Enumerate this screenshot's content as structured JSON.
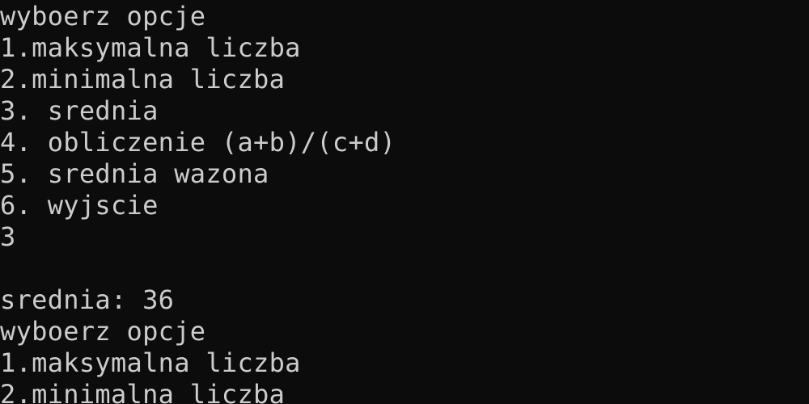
{
  "console": {
    "lines": [
      "wyboerz opcje",
      "1.maksymalna liczba",
      "2.minimalna liczba",
      "3. srednia",
      "4. obliczenie (a+b)/(c+d)",
      "5. srednia wazona",
      "6. wyjscie",
      "3",
      "",
      "srednia: 36",
      "wyboerz opcje",
      "1.maksymalna liczba",
      "2.minimalna liczba"
    ]
  },
  "colors": {
    "background": "#0c0c0c",
    "text": "#cccccc"
  }
}
